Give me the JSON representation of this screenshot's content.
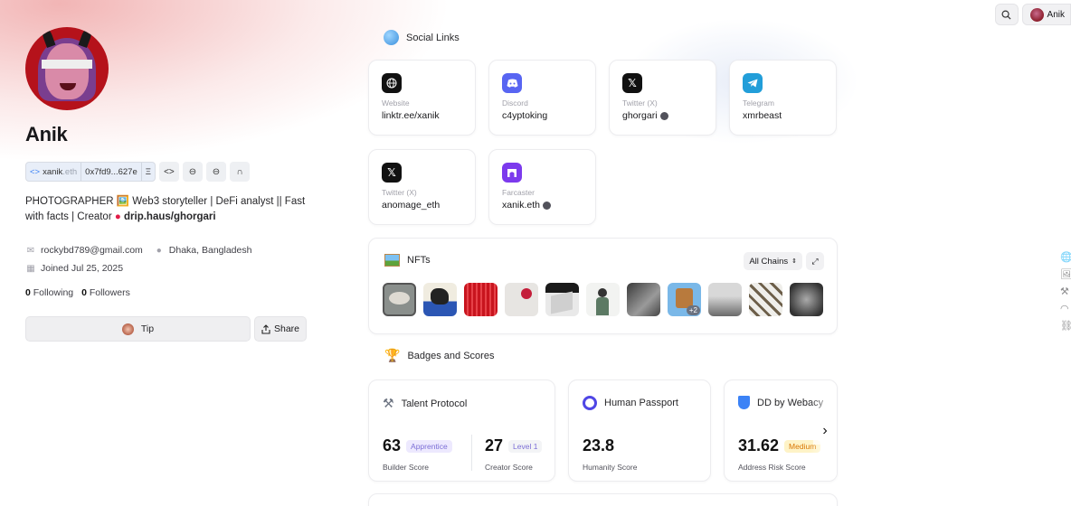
{
  "topbar": {
    "user_name": "Anik"
  },
  "profile": {
    "name": "Anik",
    "ens": "xanik",
    "ens_suffix": ".eth",
    "address": "0x7fd9...627e",
    "bio_text": "PHOTOGRAPHER 🖼️ Web3 storyteller | DeFi analyst || Fast with facts | Creator",
    "bio_link": "drip.haus/ghorgari",
    "email": "rockybd789@gmail.com",
    "location": "Dhaka, Bangladesh",
    "joined": "Joined Jul 25, 2025",
    "following_count": "0",
    "following_label": "Following",
    "followers_count": "0",
    "followers_label": "Followers",
    "tip_label": "Tip",
    "share_label": "Share"
  },
  "social": {
    "heading": "Social Links",
    "links": [
      {
        "icon": "globe-icon",
        "label": "Website",
        "value": "linktr.ee/xanik",
        "color": "#111111",
        "verified": false
      },
      {
        "icon": "discord-icon",
        "label": "Discord",
        "value": "c4yptoking",
        "color": "#5865F2",
        "verified": false
      },
      {
        "icon": "x-icon",
        "label": "Twitter (X)",
        "value": "ghorgari",
        "color": "#111111",
        "verified": true
      },
      {
        "icon": "telegram-icon",
        "label": "Telegram",
        "value": "xmrbeast",
        "color": "#229ED9",
        "verified": false
      },
      {
        "icon": "x-icon",
        "label": "Twitter (X)",
        "value": "anomage_eth",
        "color": "#111111",
        "verified": false
      },
      {
        "icon": "farcaster-icon",
        "label": "Farcaster",
        "value": "xanik.eth",
        "color": "#7C3AED",
        "verified": true
      }
    ]
  },
  "nfts": {
    "heading": "NFTs",
    "chain_filter": "All Chains",
    "more_badge": "+2"
  },
  "badges": {
    "heading": "Badges and Scores",
    "talent": {
      "title": "Talent Protocol",
      "builder_score": "63",
      "builder_tag": "Apprentice",
      "builder_label": "Builder Score",
      "creator_score": "27",
      "creator_tag": "Level 1",
      "creator_label": "Creator Score"
    },
    "passport": {
      "title": "Human Passport",
      "score": "23.8",
      "label": "Humanity Score"
    },
    "webacy": {
      "title": "DD by Webacy",
      "score": "31.62",
      "tag": "Medium",
      "label": "Address Risk Score"
    }
  },
  "colors": {
    "accent_purple": "#7C3AED",
    "discord": "#5865F2",
    "telegram": "#229ED9"
  }
}
